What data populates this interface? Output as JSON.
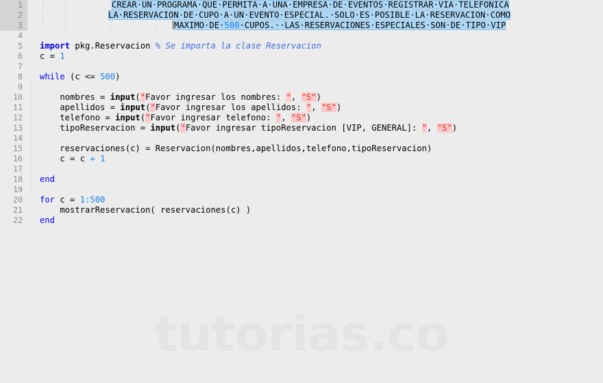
{
  "editor": {
    "title": "matlab-code-editor",
    "watermark": "tutorias.co",
    "selection_color": "#add8f7",
    "gutter_selection_color": "#d4d4d4",
    "background_color": "#ececec",
    "keyword_color": "#0000e6",
    "number_color": "#1a7ef0",
    "comment_color": "#3f6fd8",
    "string_color": "#d93025",
    "string_highlight_color": "#fbc9c9"
  },
  "line_numbers": [
    "1",
    "2",
    "3",
    "4",
    "5",
    "6",
    "7",
    "8",
    "9",
    "10",
    "11",
    "12",
    "13",
    "14",
    "15",
    "16",
    "17",
    "18",
    "19",
    "20",
    "21",
    "22"
  ],
  "header_comment": {
    "line1": "CREAR·UN·PROGRAMA·QUE·PERMITA·A·UNA·EMPRESA·DE·EVENTOS·REGISTRAR·VIA·TELEFONICA",
    "line2": "LA·RESERVACION·DE·CUPO·A·UN·EVENTO·ESPECIAL.·SOLO·ES·POSIBLE·LA·RESERVACION·COMO",
    "line3_a": "MAXIMO·DE·",
    "line3_num": "500",
    "line3_b": "·CUPOS.··LAS·RESERVACIONES·ESPECIALES·SON·DE·TIPO·VIP"
  },
  "code": {
    "l5_kw": "import",
    "l5_rest": " pkg.Reservacion ",
    "l5_comment": "% Se importa la clase Reservacion",
    "l6_a": "c = ",
    "l6_num": "1",
    "l8_kw": "while",
    "l8_a": " (c <= ",
    "l8_num": "500",
    "l8_b": ")",
    "l10_a": "    nombres = ",
    "l10_fn": "input",
    "l10_b": "(",
    "l10_q1": "\"",
    "l10_txt": "Favor ingresar los nombres: ",
    "l10_q2": "\"",
    "l10_c": ", ",
    "l10_q3": "\"S\"",
    "l10_d": ")",
    "l11_a": "    apellidos = ",
    "l11_fn": "input",
    "l11_b": "(",
    "l11_q1": "\"",
    "l11_txt": "Favor ingresar los apellidos: ",
    "l11_q2": "\"",
    "l11_c": ", ",
    "l11_q3": "\"S\"",
    "l11_d": ")",
    "l12_a": "    telefono = ",
    "l12_fn": "input",
    "l12_b": "(",
    "l12_q1": "\"",
    "l12_txt": "Favor ingresar telefono: ",
    "l12_q2": "\"",
    "l12_c": ", ",
    "l12_q3": "\"S\"",
    "l12_d": ")",
    "l13_a": "    tipoReservacion = ",
    "l13_fn": "input",
    "l13_b": "(",
    "l13_q1": "\"",
    "l13_txt": "Favor ingresar tipoReservacion [VIP, GENERAL]: ",
    "l13_q2": "\"",
    "l13_c": ", ",
    "l13_q3": "\"S\"",
    "l13_d": ")",
    "l15": "    reservaciones(c) = Reservacion(nombres,apellidos,telefono,tipoReservacion)",
    "l16_a": "    c = c ",
    "l16_op": "+",
    "l16_b": " ",
    "l16_num": "1",
    "l18_kw": "end",
    "l20_kw": "for",
    "l20_a": " c = ",
    "l20_num": "1:500",
    "l21": "    mostrarReservacion( reservaciones(c) )",
    "l22_kw": "end"
  }
}
